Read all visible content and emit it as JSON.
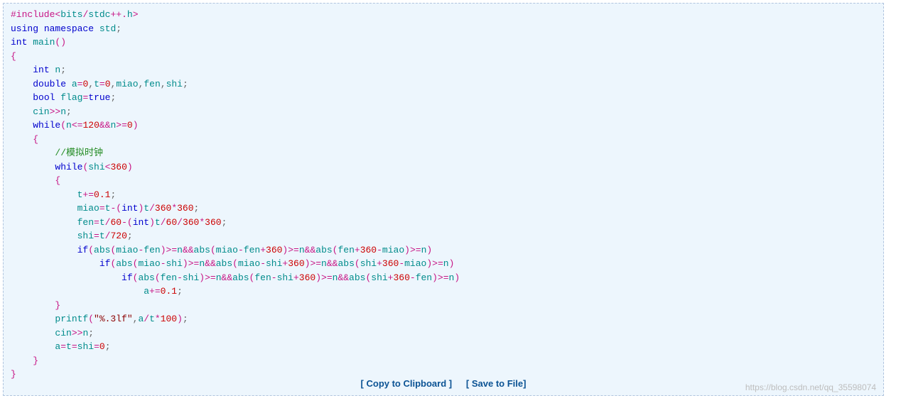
{
  "code": {
    "l1a": "#include",
    "l1b": "<",
    "l1c": "bits",
    "l1d": "/",
    "l1e": "stdc",
    "l1f": "++.",
    "l1g": "h",
    "l1h": ">",
    "l2a": "using",
    "l2b": " ",
    "l2c": "namespace",
    "l2d": " std",
    "l2e": ";",
    "l3a": "int",
    "l3b": " main",
    "l3c": "()",
    "l4": "{",
    "l5a": "    ",
    "l5b": "int",
    "l5c": " n",
    "l5d": ";",
    "l6a": "    ",
    "l6b": "double",
    "l6c": " a",
    "l6d": "=",
    "l6e": "0",
    "l6f": ",",
    "l6g": "t",
    "l6h": "=",
    "l6i": "0",
    "l6j": ",",
    "l6k": "miao",
    "l6l": ",",
    "l6m": "fen",
    "l6n": ",",
    "l6o": "shi",
    "l6p": ";",
    "l7a": "    ",
    "l7b": "bool",
    "l7c": " flag",
    "l7d": "=",
    "l7e": "true",
    "l7f": ";",
    "l8a": "    cin",
    "l8b": ">>",
    "l8c": "n",
    "l8d": ";",
    "l9a": "    ",
    "l9b": "while",
    "l9c": "(",
    "l9d": "n",
    "l9e": "<=",
    "l9f": "120",
    "l9g": "&&",
    "l9h": "n",
    "l9i": ">=",
    "l9j": "0",
    "l9k": ")",
    "l10a": "    ",
    "l10b": "{",
    "l11a": "        ",
    "l11b": "//模拟时钟",
    "l12a": "        ",
    "l12b": "while",
    "l12c": "(",
    "l12d": "shi",
    "l12e": "<",
    "l12f": "360",
    "l12g": ")",
    "l13a": "        ",
    "l13b": "{",
    "l14a": "            t",
    "l14b": "+=",
    "l14c": "0.1",
    "l14d": ";",
    "l15a": "            miao",
    "l15b": "=",
    "l15c": "t",
    "l15d": "-(",
    "l15e": "int",
    "l15f": ")",
    "l15g": "t",
    "l15h": "/",
    "l15i": "360",
    "l15j": "*",
    "l15k": "360",
    "l15l": ";",
    "l16a": "            fen",
    "l16b": "=",
    "l16c": "t",
    "l16d": "/",
    "l16e": "60",
    "l16f": "-(",
    "l16g": "int",
    "l16h": ")",
    "l16i": "t",
    "l16j": "/",
    "l16k": "60",
    "l16l": "/",
    "l16m": "360",
    "l16n": "*",
    "l16o": "360",
    "l16p": ";",
    "l17a": "            shi",
    "l17b": "=",
    "l17c": "t",
    "l17d": "/",
    "l17e": "720",
    "l17f": ";",
    "l18a": "            ",
    "l18b": "if",
    "l18c": "(",
    "l18d": "abs",
    "l18e": "(",
    "l18f": "miao",
    "l18g": "-",
    "l18h": "fen",
    "l18i": ")",
    "l18j": ">=",
    "l18k": "n",
    "l18l": "&&",
    "l18m": "abs",
    "l18n": "(",
    "l18o": "miao",
    "l18p": "-",
    "l18q": "fen",
    "l18r": "+",
    "l18s": "360",
    "l18t": ")",
    "l18u": ">=",
    "l18v": "n",
    "l18w": "&&",
    "l18x": "abs",
    "l18y": "(",
    "l18z": "fen",
    "l18A": "+",
    "l18B": "360",
    "l18C": "-",
    "l18D": "miao",
    "l18E": ")",
    "l18F": ">=",
    "l18G": "n",
    "l18H": ")",
    "l19a": "                ",
    "l19b": "if",
    "l19c": "(",
    "l19d": "abs",
    "l19e": "(",
    "l19f": "miao",
    "l19g": "-",
    "l19h": "shi",
    "l19i": ")",
    "l19j": ">=",
    "l19k": "n",
    "l19l": "&&",
    "l19m": "abs",
    "l19n": "(",
    "l19o": "miao",
    "l19p": "-",
    "l19q": "shi",
    "l19r": "+",
    "l19s": "360",
    "l19t": ")",
    "l19u": ">=",
    "l19v": "n",
    "l19w": "&&",
    "l19x": "abs",
    "l19y": "(",
    "l19z": "shi",
    "l19A": "+",
    "l19B": "360",
    "l19C": "-",
    "l19D": "miao",
    "l19E": ")",
    "l19F": ">=",
    "l19G": "n",
    "l19H": ")",
    "l20a": "                    ",
    "l20b": "if",
    "l20c": "(",
    "l20d": "abs",
    "l20e": "(",
    "l20f": "fen",
    "l20g": "-",
    "l20h": "shi",
    "l20i": ")",
    "l20j": ">=",
    "l20k": "n",
    "l20l": "&&",
    "l20m": "abs",
    "l20n": "(",
    "l20o": "fen",
    "l20p": "-",
    "l20q": "shi",
    "l20r": "+",
    "l20s": "360",
    "l20t": ")",
    "l20u": ">=",
    "l20v": "n",
    "l20w": "&&",
    "l20x": "abs",
    "l20y": "(",
    "l20z": "shi",
    "l20A": "+",
    "l20B": "360",
    "l20C": "-",
    "l20D": "fen",
    "l20E": ")",
    "l20F": ">=",
    "l20G": "n",
    "l20H": ")",
    "l21a": "                        a",
    "l21b": "+=",
    "l21c": "0.1",
    "l21d": ";",
    "l22a": "        ",
    "l22b": "}",
    "l23a": "        printf",
    "l23b": "(",
    "l23c": "\"%.3lf\"",
    "l23d": ",",
    "l23e": "a",
    "l23f": "/",
    "l23g": "t",
    "l23h": "*",
    "l23i": "100",
    "l23j": ")",
    "l23k": ";",
    "l24a": "        cin",
    "l24b": ">>",
    "l24c": "n",
    "l24d": ";",
    "l25a": "        a",
    "l25b": "=",
    "l25c": "t",
    "l25d": "=",
    "l25e": "shi",
    "l25f": "=",
    "l25g": "0",
    "l25h": ";",
    "l26a": "    ",
    "l26b": "}",
    "l27": "}"
  },
  "actions": {
    "copy": "[ Copy to Clipboard ]",
    "save": "[ Save to File]"
  },
  "watermark": "https://blog.csdn.net/qq_35598074"
}
